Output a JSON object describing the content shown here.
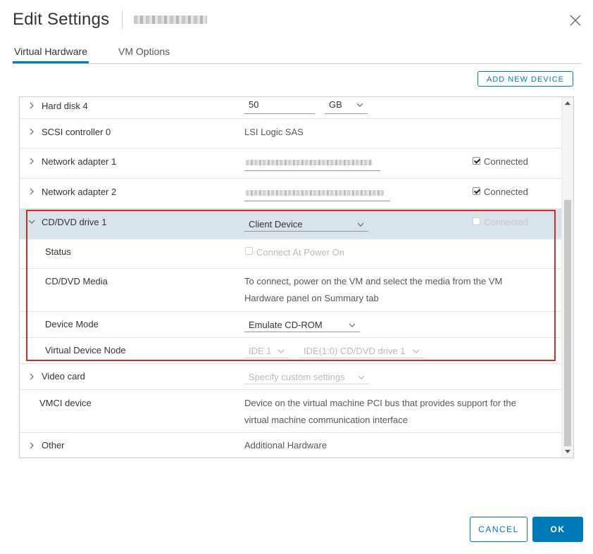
{
  "dialog": {
    "title": "Edit Settings",
    "vm_name": "",
    "close_icon": "close-icon"
  },
  "tabs": [
    {
      "label": "Virtual Hardware",
      "active": true
    },
    {
      "label": "VM Options",
      "active": false
    }
  ],
  "toolbar": {
    "add_device_label": "ADD NEW DEVICE"
  },
  "rows": {
    "hard_disk": {
      "label": "Hard disk 4",
      "size_value": "50",
      "unit": "GB"
    },
    "scsi": {
      "label": "SCSI controller 0",
      "value": "LSI Logic SAS"
    },
    "net1": {
      "label": "Network adapter 1",
      "network": "",
      "connected_label": "Connected",
      "connected": true
    },
    "net2": {
      "label": "Network adapter 2",
      "network": "",
      "connected_label": "Connected",
      "connected": true
    },
    "cd": {
      "label": "CD/DVD drive 1",
      "device": "Client Device",
      "connected_label": "Connected",
      "connected": false
    },
    "status": {
      "label": "Status",
      "power_on_label": "Connect At Power On"
    },
    "media": {
      "label": "CD/DVD Media",
      "line1": "To connect, power on the VM and select the media from the VM",
      "line2": "Hardware panel on Summary tab"
    },
    "mode": {
      "label": "Device Mode",
      "value": "Emulate CD-ROM"
    },
    "node": {
      "label": "Virtual Device Node",
      "controller": "IDE 1",
      "slot": "IDE(1:0) CD/DVD drive 1"
    },
    "video": {
      "label": "Video card",
      "value": "Specify custom settings"
    },
    "vmci": {
      "label": "VMCI device",
      "line1": "Device on the virtual machine PCI bus that provides support for the",
      "line2": "virtual machine communication interface"
    },
    "other": {
      "label": "Other",
      "value": "Additional Hardware"
    }
  },
  "footer": {
    "cancel_label": "CANCEL",
    "ok_label": "OK"
  },
  "colors": {
    "accent": "#0079b8",
    "selected_row": "#d9e4ea",
    "highlight": "#d22b2b"
  }
}
